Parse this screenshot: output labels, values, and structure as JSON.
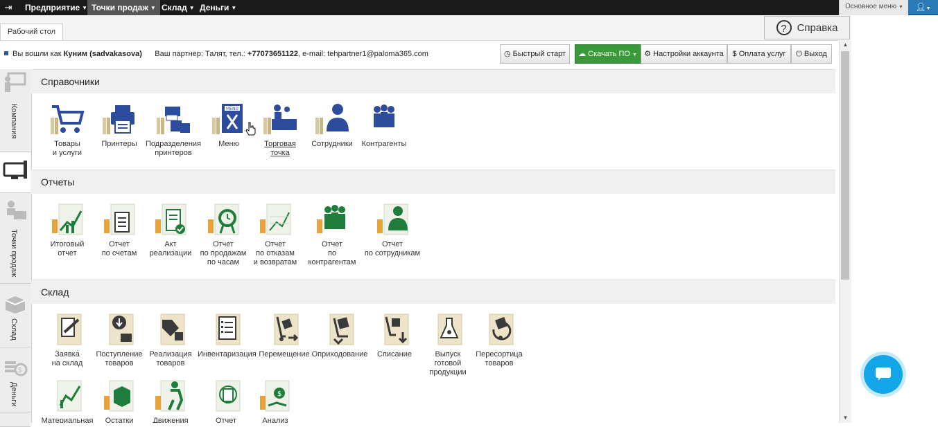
{
  "navbar": {
    "items": [
      {
        "label": "Предприятие"
      },
      {
        "label": "Точки продаж"
      },
      {
        "label": "Склад"
      },
      {
        "label": "Деньги"
      }
    ],
    "main_menu_label": "Основное меню"
  },
  "tabs": [
    {
      "label": "Рабочий стол"
    }
  ],
  "help_label": "Справка",
  "info": {
    "logged_prefix": "Вы вошли как",
    "user": "Куним (sadvakasova)",
    "partner_prefix": "Ваш партнер: Талят, тел.:",
    "phone": "+77073651122",
    "email_text": ", e-mail: tehpartner1@paloma365.com"
  },
  "buttons": {
    "quick_start": "Быстрый старт",
    "download": "Скачать ПО",
    "account_settings": "Настройки аккаунта",
    "payment": "Оплата услуг",
    "logout": "Выход"
  },
  "sidebar": [
    {
      "label": "Компания"
    },
    {
      "label": ""
    },
    {
      "label": "Точки продаж"
    },
    {
      "label": "Склад"
    },
    {
      "label": "Деньги"
    }
  ],
  "sections": {
    "refs": {
      "title": "Справочники",
      "items": [
        {
          "label": "Товары\nи услуги",
          "icon": "cart-icon"
        },
        {
          "label": "Принтеры",
          "icon": "printer-icon"
        },
        {
          "label": "Подразделения\nпринтеров",
          "icon": "printer-groups-icon"
        },
        {
          "label": "Меню",
          "icon": "menu-board-icon"
        },
        {
          "label": "Торговая\nточка",
          "icon": "store-counter-icon"
        },
        {
          "label": "Сотрудники",
          "icon": "employee-icon"
        },
        {
          "label": "Контрагенты",
          "icon": "contractors-icon"
        }
      ]
    },
    "reports": {
      "title": "Отчеты",
      "items": [
        {
          "label": "Итоговый\nотчет",
          "icon": "summary-report-icon"
        },
        {
          "label": "Отчет\nпо счетам",
          "icon": "bills-report-icon"
        },
        {
          "label": "Акт\nреализации",
          "icon": "sales-act-icon"
        },
        {
          "label": "Отчет\nпо продажам\nпо часам",
          "icon": "hourly-sales-icon"
        },
        {
          "label": "Отчет\nпо отказам\nи возвратам",
          "icon": "refunds-report-icon"
        },
        {
          "label": "Отчет\nпо контрагентам",
          "icon": "contractors-report-icon"
        },
        {
          "label": "Отчет\nпо сотрудникам",
          "icon": "employees-report-icon"
        }
      ]
    },
    "warehouse": {
      "title": "Склад",
      "items": [
        {
          "label": "Заявка\nна склад",
          "icon": "request-icon"
        },
        {
          "label": "Поступление\nтоваров",
          "icon": "receipt-icon"
        },
        {
          "label": "Реализация\nтоваров",
          "icon": "goods-sale-icon"
        },
        {
          "label": "Инвентаризация",
          "icon": "inventory-icon"
        },
        {
          "label": "Перемещение",
          "icon": "transfer-icon"
        },
        {
          "label": "Оприходование",
          "icon": "posting-icon"
        },
        {
          "label": "Списание",
          "icon": "write-off-icon"
        },
        {
          "label": "Выпуск\nготовой\nпродукции",
          "icon": "production-icon"
        },
        {
          "label": "Пересортица\nтоваров",
          "icon": "regrading-icon"
        },
        {
          "label": "Материальная",
          "icon": "material-report-icon"
        },
        {
          "label": "Остатки",
          "icon": "stock-icon"
        },
        {
          "label": "Движения",
          "icon": "movements-icon"
        },
        {
          "label": "Отчет",
          "icon": "report-icon"
        },
        {
          "label": "Анализ",
          "icon": "analysis-icon"
        }
      ]
    }
  },
  "colors": {
    "navbar": "#1a1a1a",
    "icon_blue": "#2d4d9c",
    "icon_green": "#1e7d3a",
    "icon_dark": "#3a3a3a",
    "button_green": "#3a9a3a",
    "chat": "#12a6e8"
  }
}
